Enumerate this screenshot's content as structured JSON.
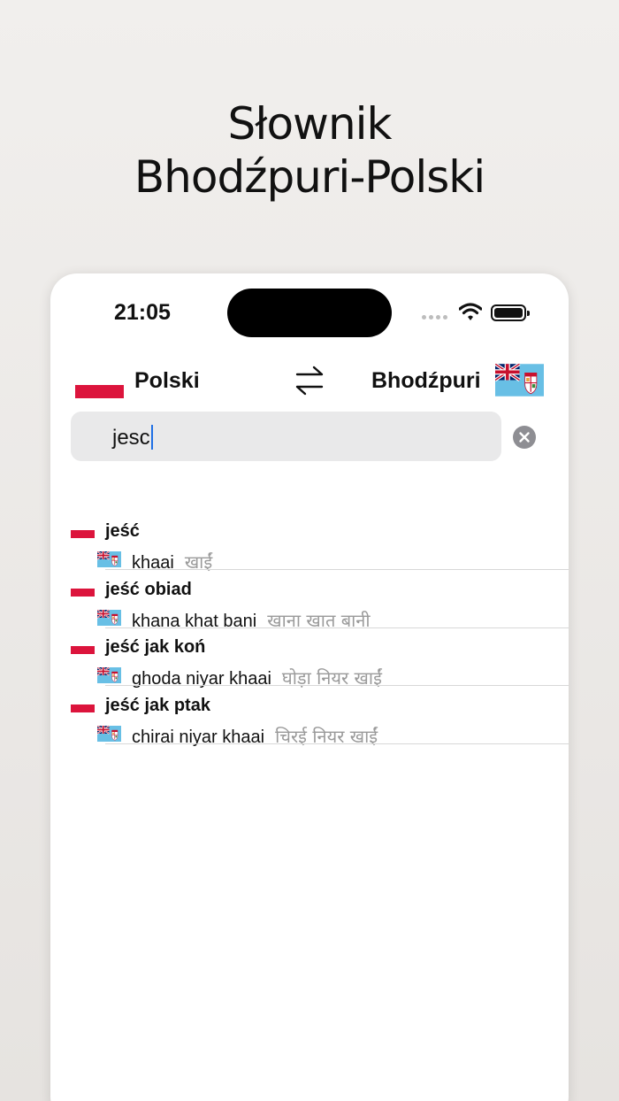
{
  "promo": {
    "title_line1": "Słownik",
    "title_line2": "Bhodźpuri-Polski"
  },
  "status_bar": {
    "time": "21:05"
  },
  "language_bar": {
    "source_language": "Polski",
    "target_language": "Bhodźpuri",
    "source_flag": "poland-flag",
    "target_flag": "fiji-flag",
    "swap_icon": "swap-arrows-icon"
  },
  "search": {
    "value": "jesc",
    "clear_icon": "clear-circle-icon"
  },
  "results": [
    {
      "headword": "jeść",
      "transliteration": "khaai",
      "native": "खाईं"
    },
    {
      "headword": "jeść obiad",
      "transliteration": "khana khat bani",
      "native": "खाना खात बानी"
    },
    {
      "headword": "jeść jak koń",
      "transliteration": "ghoda niyar khaai",
      "native": "घोड़ा नियर खाईं"
    },
    {
      "headword": "jeść jak ptak",
      "transliteration": "chirai niyar khaai",
      "native": "चिरई नियर खाईं"
    }
  ],
  "colors": {
    "poland_red": "#dc143c",
    "fiji_blue": "#68bfe5",
    "caret_blue": "#1f6fe5",
    "secondary_text": "#9a9a9a"
  }
}
